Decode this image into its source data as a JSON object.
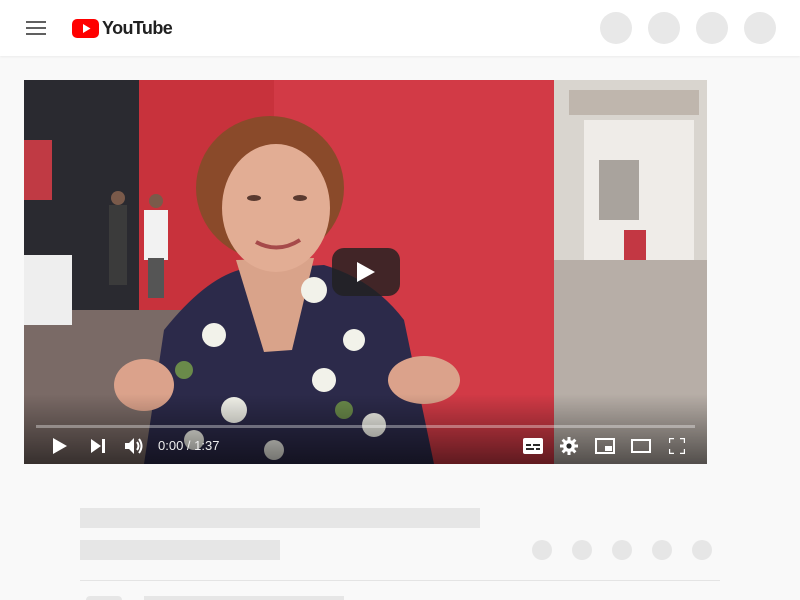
{
  "header": {
    "logo_text": "YouTube",
    "brand_color": "#ff0000",
    "menu_icon": "hamburger-menu-icon"
  },
  "player": {
    "time_display": "0:00 / 1:37",
    "current_time": "0:00",
    "duration": "1:37",
    "progress_fraction": 0,
    "controls": [
      "play",
      "next",
      "volume",
      "subtitles",
      "settings",
      "miniplayer",
      "theater-mode",
      "fullscreen"
    ]
  },
  "colors": {
    "accent": "#ff0000",
    "page_background": "#f9f9f9",
    "skeleton": "#e6e6e6"
  }
}
